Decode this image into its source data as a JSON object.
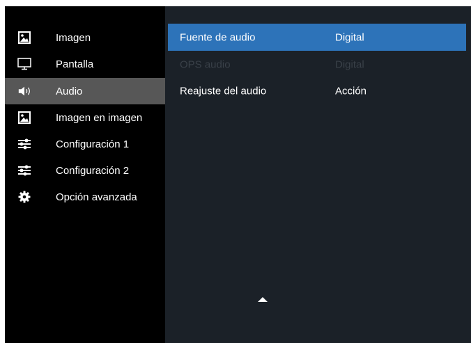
{
  "sidebar": {
    "items": [
      {
        "label": "Imagen",
        "icon": "picture-icon",
        "active": false
      },
      {
        "label": "Pantalla",
        "icon": "monitor-icon",
        "active": false
      },
      {
        "label": "Audio",
        "icon": "speaker-icon",
        "active": true
      },
      {
        "label": "Imagen en imagen",
        "icon": "picture-in-picture-icon",
        "active": false
      },
      {
        "label": "Configuración 1",
        "icon": "sliders-icon",
        "active": false
      },
      {
        "label": "Configuración 2",
        "icon": "sliders-icon",
        "active": false
      },
      {
        "label": "Opción avanzada",
        "icon": "gear-icon",
        "active": false
      }
    ]
  },
  "audio_menu": {
    "rows": [
      {
        "label": "Fuente de audio",
        "value": "Digital",
        "state": "selected"
      },
      {
        "label": "OPS audio",
        "value": "Digital",
        "state": "disabled"
      },
      {
        "label": "Reajuste del audio",
        "value": "Acción",
        "state": "normal"
      }
    ],
    "scroll_indicator": "scroll-up-arrow-icon"
  },
  "colors": {
    "background": "#000000",
    "panel": "#1b2128",
    "selected_row": "#2d73b9",
    "active_menu_item": "#575757",
    "disabled_text": "#3a4149",
    "text": "#ffffff"
  }
}
